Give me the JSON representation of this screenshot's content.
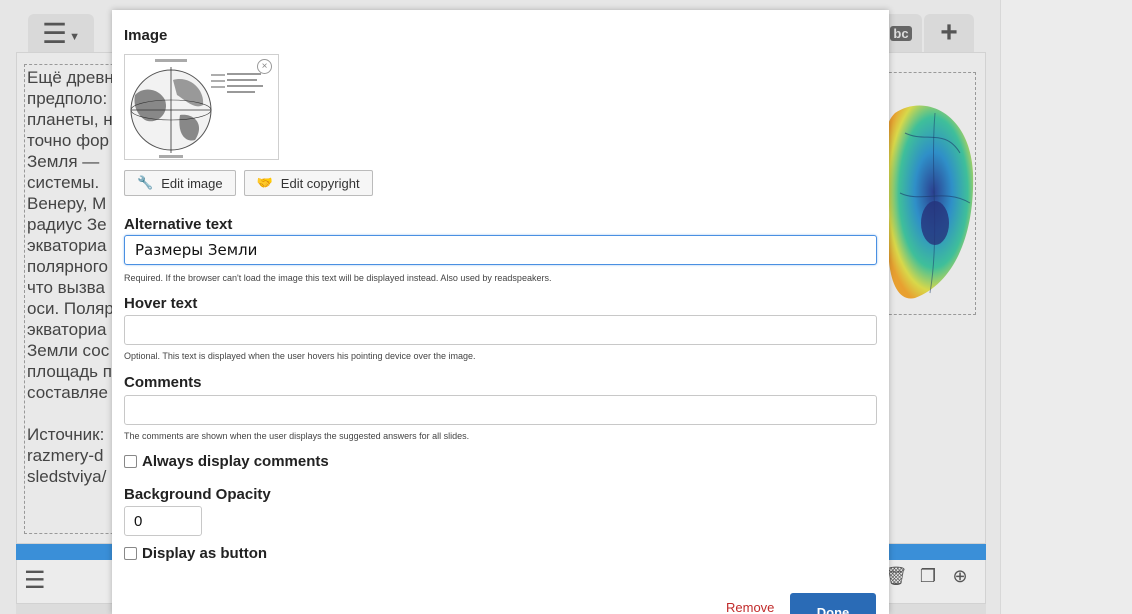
{
  "background": {
    "menu_icon": "hamburger-icon",
    "text_tool_label": "bc",
    "add_label": "+",
    "text_lines": [
      "Ещё древн",
      "предполо:",
      "планеты, н",
      "точно фор",
      "Земля — ",
      "системы.",
      "Венеру, М",
      "радиус Зе",
      "экваториа",
      "полярного",
      "что вызва",
      "оси. Поляр",
      "экваториа",
      "Земли сос",
      "площадь п",
      "составляе",
      "",
      "Источник:",
      "razmery-d",
      "sledstviya/"
    ],
    "bottom_icons": [
      "trash-icon",
      "copy-icon",
      "plus-circle-icon"
    ]
  },
  "dialog": {
    "image": {
      "label": "Image",
      "close_glyph": "×"
    },
    "edit_image_label": "Edit image",
    "edit_copyright_label": "Edit copyright",
    "alt_text": {
      "label": "Alternative text",
      "value": "Размеры Земли",
      "description": "Required. If the browser can't load the image this text will be displayed instead. Also used by readspeakers."
    },
    "hover_text": {
      "label": "Hover text",
      "value": "",
      "description": "Optional. This text is displayed when the user hovers his pointing device over the image."
    },
    "comments": {
      "label": "Comments",
      "value": "",
      "description": "The comments are shown when the user displays the suggested answers for all slides."
    },
    "always_display_comments_label": "Always display comments",
    "background_opacity": {
      "label": "Background Opacity",
      "value": "0"
    },
    "display_as_button_label": "Display as button",
    "remove_label": "Remove",
    "done_label": "Done"
  },
  "colors": {
    "accent_blue": "#2a6bb6",
    "remove_red": "#c12b2b",
    "slide_bar": "#3a8fd8"
  }
}
